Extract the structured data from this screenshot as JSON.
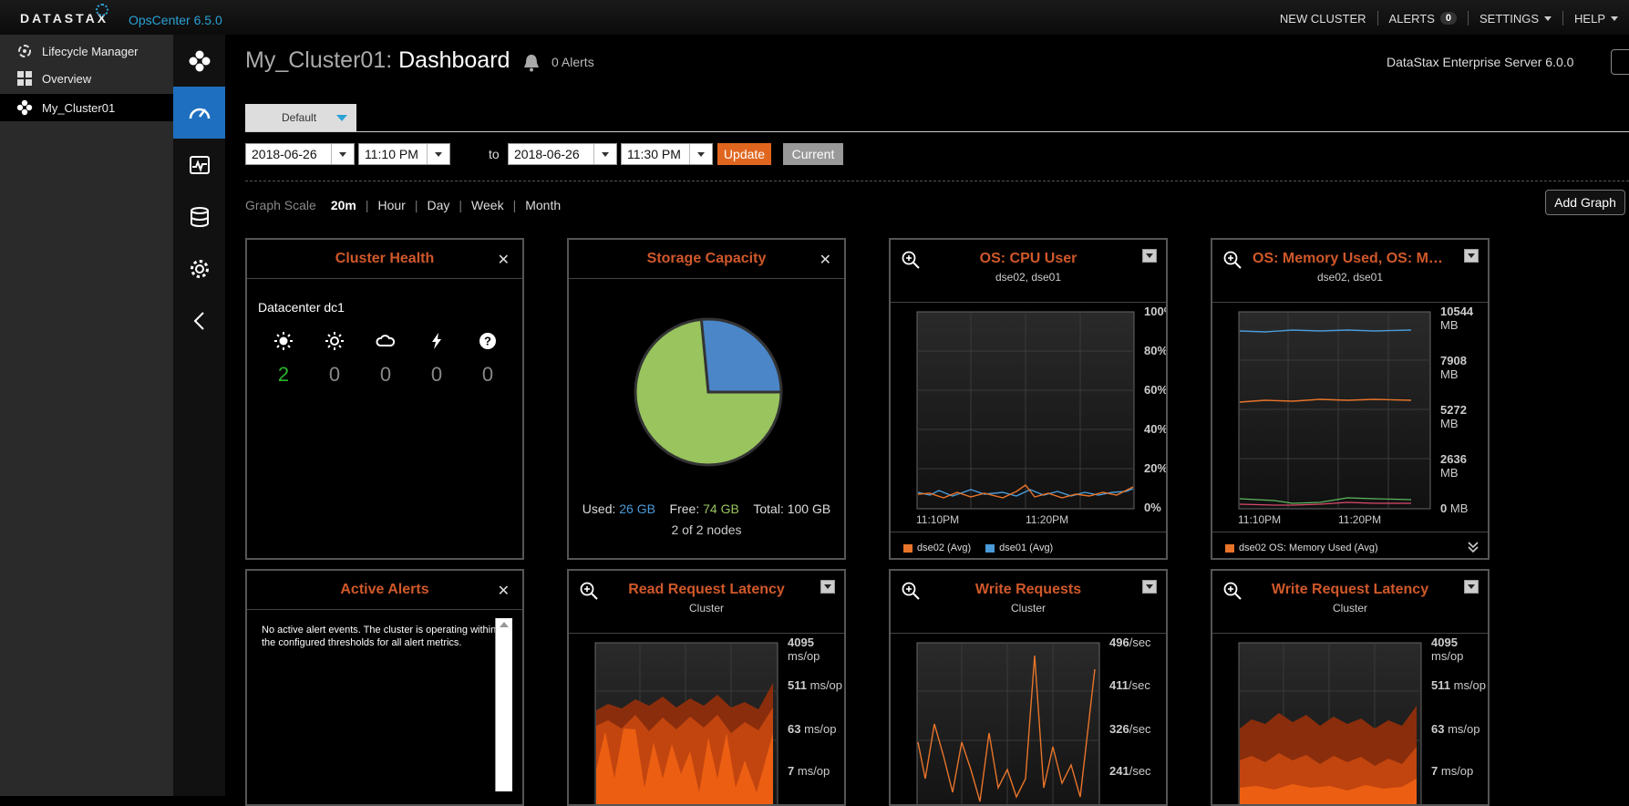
{
  "topbar": {
    "brand": "DATASTAX",
    "product": "OpsCenter 6.5.0",
    "new_cluster": "NEW CLUSTER",
    "alerts_label": "ALERTS",
    "alerts_count": "0",
    "settings": "SETTINGS",
    "help": "HELP"
  },
  "leftnav": {
    "items": [
      {
        "label": "Lifecycle Manager",
        "icon": "lifecycle-icon"
      },
      {
        "label": "Overview",
        "icon": "grid-icon"
      },
      {
        "label": "My_Cluster01",
        "icon": "cluster-icon",
        "active": true
      }
    ]
  },
  "rail": {
    "icons": [
      "cluster-icon",
      "dashboard-gauge-icon",
      "activity-icon",
      "database-icon",
      "gear-icon",
      "collapse-left-icon"
    ]
  },
  "header": {
    "cluster": "My_Cluster01:",
    "page": "Dashboard",
    "alerts": "0 Alerts",
    "server": "DataStax Enterprise Server 6.0.0"
  },
  "tabs": {
    "active": "Default"
  },
  "timerange": {
    "from_date": "2018-06-26",
    "from_time": "11:10 PM",
    "to_label": "to",
    "to_date": "2018-06-26",
    "to_time": "11:30 PM",
    "update": "Update",
    "current": "Current"
  },
  "graphscale": {
    "label": "Graph Scale",
    "options": [
      "20m",
      "Hour",
      "Day",
      "Week",
      "Month"
    ],
    "selected": "20m",
    "add_graph": "Add Graph"
  },
  "widgets": {
    "health": {
      "title": "Cluster Health",
      "datacenter": "Datacenter dc1",
      "counts": [
        {
          "icon": "sun-icon",
          "value": "2"
        },
        {
          "icon": "sun-outline-icon",
          "value": "0"
        },
        {
          "icon": "cloud-icon",
          "value": "0"
        },
        {
          "icon": "lightning-icon",
          "value": "0"
        },
        {
          "icon": "question-icon",
          "value": "0"
        }
      ]
    },
    "storage": {
      "title": "Storage Capacity",
      "used_label": "Used:",
      "used": "26 GB",
      "free_label": "Free:",
      "free": "74 GB",
      "total": "Total: 100 GB",
      "nodes": "2 of 2 nodes",
      "colors": {
        "used": "#4a86c8",
        "free": "#99c45e"
      }
    },
    "cpu": {
      "title": "OS: CPU User",
      "subtitle": "dse02, dse01",
      "yticks": [
        "100%",
        "80%",
        "60%",
        "40%",
        "20%",
        "0%"
      ],
      "xticks": [
        "11:10PM",
        "11:20PM"
      ],
      "legend": [
        {
          "label": "dse02 (Avg)",
          "color": "#e8742a"
        },
        {
          "label": "dse01 (Avg)",
          "color": "#4a9ad8"
        }
      ]
    },
    "memory": {
      "title": "OS: Memory Used, OS: Memo...",
      "subtitle": "dse02, dse01",
      "yticks": [
        {
          "v": "10544",
          "u": "MB"
        },
        {
          "v": "7908",
          "u": "MB"
        },
        {
          "v": "5272",
          "u": "MB"
        },
        {
          "v": "2636",
          "u": "MB"
        },
        {
          "v": "0",
          "u": "MB"
        }
      ],
      "xticks": [
        "11:10PM",
        "11:20PM"
      ],
      "legend": [
        {
          "label": "dse02 OS: Memory Used (Avg)",
          "color": "#e8742a"
        }
      ]
    },
    "alerts": {
      "title": "Active Alerts",
      "message": "No active alert events. The cluster is operating within the configured thresholds for all alert metrics."
    },
    "read_latency": {
      "title": "Read Request Latency",
      "subtitle": "Cluster",
      "yticks": [
        {
          "v": "4095",
          "u": "ms/op"
        },
        {
          "v": "511",
          "u": "ms/op"
        },
        {
          "v": "63",
          "u": "ms/op"
        },
        {
          "v": "7",
          "u": "ms/op"
        }
      ]
    },
    "write_requests": {
      "title": "Write Requests",
      "subtitle": "Cluster",
      "yticks": [
        {
          "v": "496",
          "u": "/sec"
        },
        {
          "v": "411",
          "u": "/sec"
        },
        {
          "v": "326",
          "u": "/sec"
        },
        {
          "v": "241",
          "u": "/sec"
        }
      ]
    },
    "write_latency": {
      "title": "Write Request Latency",
      "subtitle": "Cluster",
      "yticks": [
        {
          "v": "4095",
          "u": "ms/op"
        },
        {
          "v": "511",
          "u": "ms/op"
        },
        {
          "v": "63",
          "u": "ms/op"
        },
        {
          "v": "7",
          "u": "ms/op"
        }
      ]
    }
  }
}
